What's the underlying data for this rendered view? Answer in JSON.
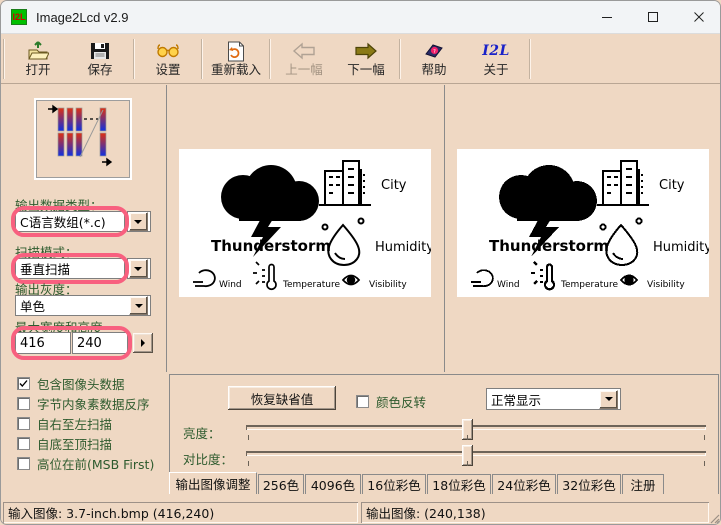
{
  "window": {
    "title": "Image2Lcd v2.9",
    "app_icon_text": "I2L",
    "minimize": "minimize-icon",
    "maximize": "maximize-icon",
    "close": "close-icon"
  },
  "toolbar": {
    "buttons": [
      {
        "label": "打开",
        "icon": "open-folder-icon",
        "disabled": false
      },
      {
        "label": "保存",
        "icon": "floppy-save-icon",
        "disabled": false
      },
      {
        "label": "设置",
        "icon": "glasses-settings-icon",
        "disabled": false
      },
      {
        "label": "重新载入",
        "icon": "reload-file-icon",
        "disabled": false
      },
      {
        "label": "上一幅",
        "icon": "arrow-left-icon",
        "disabled": true
      },
      {
        "label": "下一幅",
        "icon": "arrow-right-icon",
        "disabled": false
      },
      {
        "label": "帮助",
        "icon": "help-book-icon",
        "disabled": false
      },
      {
        "label": "关于",
        "icon": "izl-logo-icon",
        "disabled": false
      }
    ]
  },
  "left_panel": {
    "scan_preview_name": "vertical-scan-diagram",
    "output_type": {
      "label": "输出数据类型：",
      "value": "C语言数组(*.c)",
      "highlighted": true
    },
    "scan_mode": {
      "label": "扫描模式：",
      "value": "垂直扫描",
      "highlighted": true
    },
    "output_gray": {
      "label": "输出灰度：",
      "value": "单色",
      "highlighted": false
    },
    "max_size": {
      "label": "最大宽度和高度",
      "width": "416",
      "height": "240",
      "highlighted": true
    },
    "checkboxes": [
      {
        "label": "包含图像头数据",
        "checked": true
      },
      {
        "label": "字节内象素数据反序",
        "checked": false
      },
      {
        "label": "自右至左扫描",
        "checked": false
      },
      {
        "label": "自底至顶扫描",
        "checked": false
      },
      {
        "label": "高位在前(MSB First)",
        "checked": false
      }
    ]
  },
  "preview": {
    "left_name": "source-image-preview",
    "right_name": "output-image-preview",
    "content": {
      "main_label": "Thunderstorm",
      "city_label": "City",
      "humidity_label": "Humidity",
      "wind_label": "Wind",
      "temperature_label": "Temperature",
      "visibility_label": "Visibility"
    }
  },
  "adjust_panel": {
    "restore_defaults": "恢复缺省值",
    "invert_color": {
      "label": "颜色反转",
      "checked": false
    },
    "display_mode": "正常显示",
    "brightness_label": "亮度：",
    "contrast_label": "对比度：",
    "brightness_value": 50,
    "contrast_value": 50
  },
  "tabs": [
    {
      "label": "输出图像调整",
      "active": true
    },
    {
      "label": "256色",
      "active": false
    },
    {
      "label": "4096色",
      "active": false
    },
    {
      "label": "16位彩色",
      "active": false
    },
    {
      "label": "18位彩色",
      "active": false
    },
    {
      "label": "24位彩色",
      "active": false
    },
    {
      "label": "32位彩色",
      "active": false
    },
    {
      "label": "注册",
      "active": false
    }
  ],
  "status": {
    "input": "输入图像: 3.7-inch.bmp (416,240)",
    "output": "输出图像: (240,138)"
  },
  "colors": {
    "background": "#efd8c3",
    "titlebar": "#f2f4f6",
    "label_green": "#2e5b2e",
    "highlight_red": "#f8607f",
    "accent_blue": "#1a22c8"
  }
}
